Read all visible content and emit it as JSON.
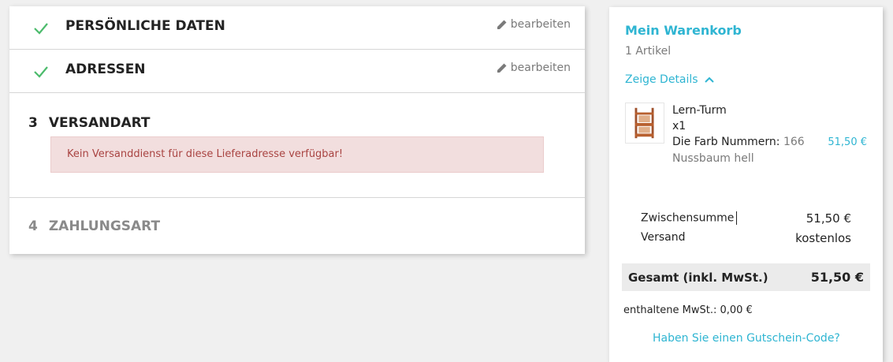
{
  "steps": [
    {
      "title": "Persönliche Daten",
      "edit": "bearbeiten"
    },
    {
      "title": "Adressen",
      "edit": "bearbeiten"
    }
  ],
  "current_step": {
    "number": "3",
    "title": "VERSANDART",
    "alert": "Kein Versanddienst für diese Lieferadresse verfügbar!"
  },
  "pending_step": {
    "number": "4",
    "title": "ZAHLUNGSART"
  },
  "cart": {
    "title": "Mein Warenkorb",
    "count": "1 Artikel",
    "details_toggle": "Zeige Details",
    "product": {
      "name": "Lern-Turm",
      "qty": "x1",
      "attr_label": "Die Farb Nummern:",
      "attr_value": "166",
      "attr_value2": "Nussbaum hell",
      "price": "51,50 €"
    },
    "subtotal_label": "Zwischensumme",
    "subtotal_value": "51,50 €",
    "shipping_label": "Versand",
    "shipping_value": "kostenlos",
    "total_label": "Gesamt (inkl. MwSt.)",
    "total_value": "51,50 €",
    "tax_text": "enthaltene MwSt.: 0,00 €",
    "voucher_link": "Haben Sie einen Gutschein-Code?"
  },
  "colors": {
    "accent": "#2fb5d2",
    "check": "#4cbb6c",
    "alert_bg": "#f2dede",
    "alert_text": "#a94442"
  }
}
